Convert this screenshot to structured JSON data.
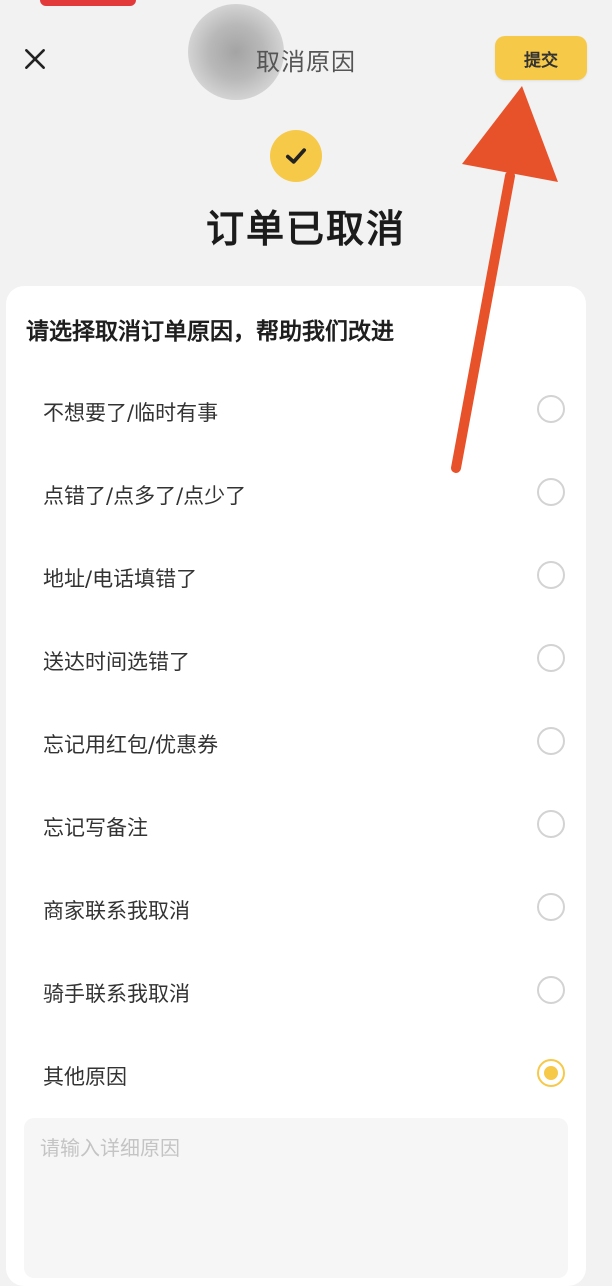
{
  "header": {
    "title": "取消原因",
    "submit_label": "提交",
    "close_icon": "close-icon"
  },
  "status": {
    "icon": "check-circle-icon",
    "title": "订单已取消"
  },
  "form": {
    "prompt": "请选择取消订单原因，帮助我们改进",
    "reasons": [
      {
        "label": "不想要了/临时有事",
        "selected": false
      },
      {
        "label": "点错了/点多了/点少了",
        "selected": false
      },
      {
        "label": "地址/电话填错了",
        "selected": false
      },
      {
        "label": "送达时间选错了",
        "selected": false
      },
      {
        "label": "忘记用红包/优惠券",
        "selected": false
      },
      {
        "label": "忘记写备注",
        "selected": false
      },
      {
        "label": "商家联系我取消",
        "selected": false
      },
      {
        "label": "骑手联系我取消",
        "selected": false
      },
      {
        "label": "其他原因",
        "selected": true
      }
    ],
    "detail_placeholder": "请输入详细原因"
  },
  "colors": {
    "accent": "#f7c948",
    "arrow": "#e8522a"
  }
}
